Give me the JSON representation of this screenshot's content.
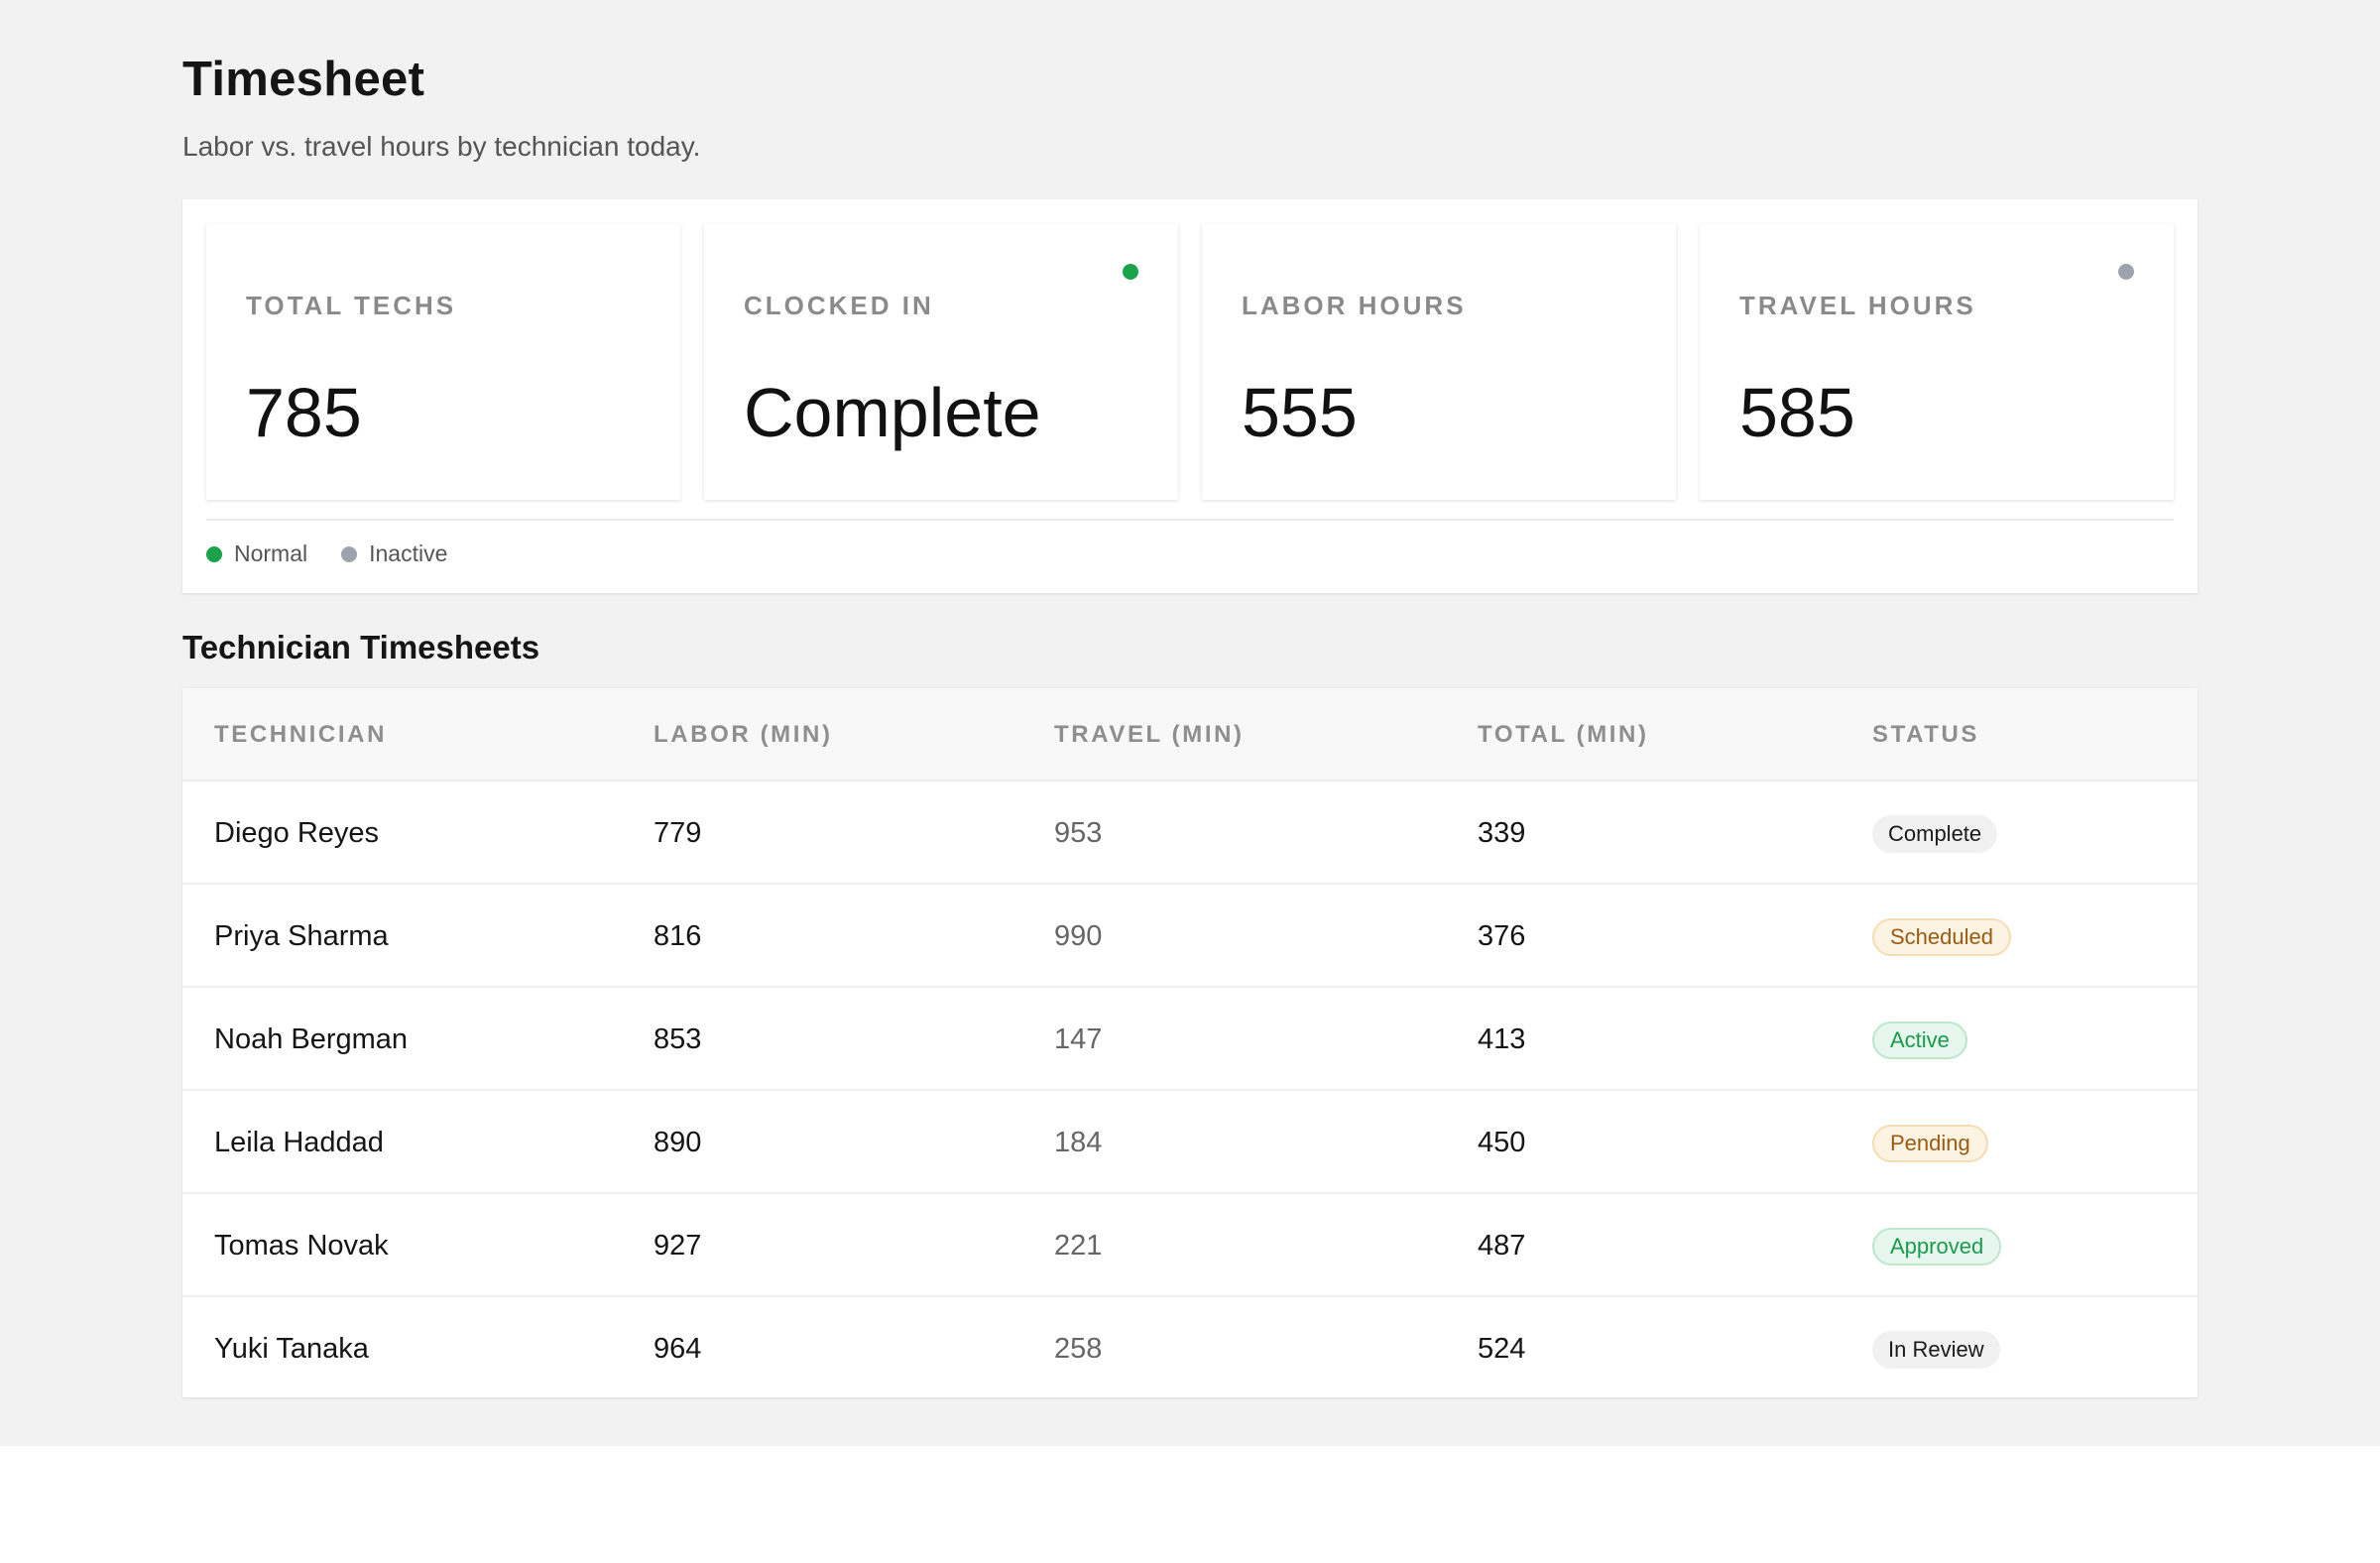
{
  "page": {
    "title": "Timesheet",
    "subtitle": "Labor vs. travel hours by technician today."
  },
  "stats": [
    {
      "label": "TOTAL TECHS",
      "value": "785",
      "indicator": null
    },
    {
      "label": "CLOCKED IN",
      "value": "Complete",
      "indicator": "green"
    },
    {
      "label": "LABOR HOURS",
      "value": "555",
      "indicator": null
    },
    {
      "label": "TRAVEL HOURS",
      "value": "585",
      "indicator": "gray"
    }
  ],
  "legend": [
    {
      "label": "Normal",
      "color": "#1aa34a"
    },
    {
      "label": "Inactive",
      "color": "#9ca3af"
    }
  ],
  "table": {
    "title": "Technician Timesheets",
    "columns": [
      "TECHNICIAN",
      "LABOR (MIN)",
      "TRAVEL (MIN)",
      "TOTAL (MIN)",
      "STATUS"
    ],
    "rows": [
      {
        "technician": "Diego Reyes",
        "labor": "779",
        "travel": "953",
        "total": "339",
        "status": "Complete",
        "tone": "neutral"
      },
      {
        "technician": "Priya Sharma",
        "labor": "816",
        "travel": "990",
        "total": "376",
        "status": "Scheduled",
        "tone": "amber"
      },
      {
        "technician": "Noah Bergman",
        "labor": "853",
        "travel": "147",
        "total": "413",
        "status": "Active",
        "tone": "green"
      },
      {
        "technician": "Leila Haddad",
        "labor": "890",
        "travel": "184",
        "total": "450",
        "status": "Pending",
        "tone": "amber"
      },
      {
        "technician": "Tomas Novak",
        "labor": "927",
        "travel": "221",
        "total": "487",
        "status": "Approved",
        "tone": "green"
      },
      {
        "technician": "Yuki Tanaka",
        "labor": "964",
        "travel": "258",
        "total": "524",
        "status": "In Review",
        "tone": "neutral"
      }
    ]
  },
  "colors": {
    "green": "#1aa34a",
    "gray": "#9ca3af"
  }
}
